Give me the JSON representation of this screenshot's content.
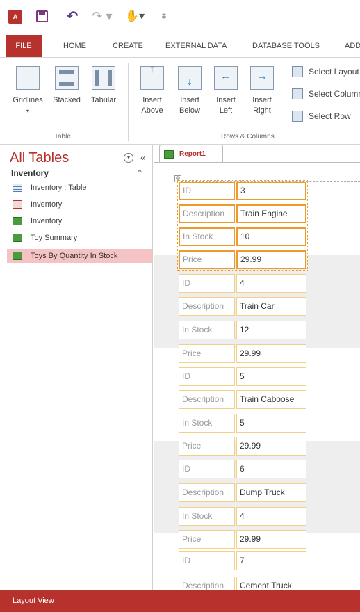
{
  "quick_access": {
    "app_icon_label": "A",
    "items": [
      "save-icon",
      "undo-icon",
      "redo-icon",
      "touch-mode-icon",
      "customize-toolbar-icon"
    ]
  },
  "ribbon_tabs": [
    "FILE",
    "HOME",
    "CREATE",
    "EXTERNAL DATA",
    "DATABASE TOOLS",
    "ADD"
  ],
  "ribbon": {
    "table_group": {
      "label": "Table",
      "buttons": [
        {
          "label": "Gridlines",
          "icon": "gridlines-icon"
        },
        {
          "label": "Stacked",
          "icon": "stacked-layout-icon"
        },
        {
          "label": "Tabular",
          "icon": "tabular-layout-icon"
        }
      ]
    },
    "rows_columns_group": {
      "label": "Rows & Columns",
      "buttons": [
        {
          "line1": "Insert",
          "line2": "Above",
          "icon": "insert-above-icon"
        },
        {
          "line1": "Insert",
          "line2": "Below",
          "icon": "insert-below-icon"
        },
        {
          "line1": "Insert",
          "line2": "Left",
          "icon": "insert-left-icon"
        },
        {
          "line1": "Insert",
          "line2": "Right",
          "icon": "insert-right-icon"
        }
      ],
      "select_items": [
        "Select Layout",
        "Select Column",
        "Select Row"
      ]
    }
  },
  "nav_pane": {
    "title": "All Tables",
    "group": "Inventory",
    "items": [
      {
        "label": "Inventory : Table",
        "icon": "table-icon"
      },
      {
        "label": "Inventory",
        "icon": "form-icon"
      },
      {
        "label": "Inventory",
        "icon": "report-icon"
      },
      {
        "label": "Toy Summary",
        "icon": "report-icon"
      },
      {
        "label": "Toys By Quantity In Stock",
        "icon": "report-icon",
        "selected": true
      }
    ]
  },
  "document": {
    "tab_label": "Report1",
    "field_labels": [
      "ID",
      "Description",
      "In Stock",
      "Price"
    ],
    "records": [
      {
        "id": "3",
        "description": "Train Engine",
        "in_stock": "10",
        "price": "29.99"
      },
      {
        "id": "4",
        "description": "Train Car",
        "in_stock": "12",
        "price": "29.99"
      },
      {
        "id": "5",
        "description": "Train Caboose",
        "in_stock": "5",
        "price": "29.99"
      },
      {
        "id": "6",
        "description": "Dump Truck",
        "in_stock": "4",
        "price": "29.99"
      },
      {
        "id": "7",
        "description": "Cement Truck",
        "in_stock": "",
        "price": ""
      }
    ]
  },
  "status_bar": {
    "text": "Layout View"
  },
  "colors": {
    "accent": "#b7312d",
    "selection_border": "#ee9b2e",
    "field_border": "#f4cf86",
    "nav_selected": "#f6c3c4"
  }
}
